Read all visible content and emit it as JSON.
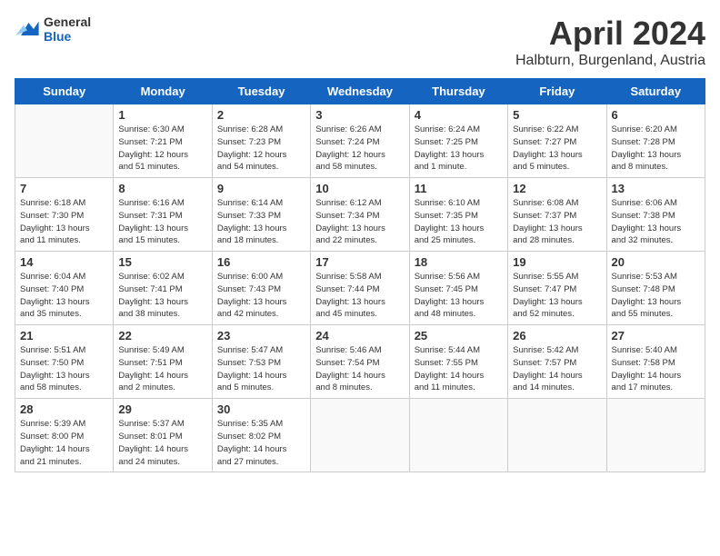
{
  "header": {
    "logo_general": "General",
    "logo_blue": "Blue",
    "month_title": "April 2024",
    "location": "Halbturn, Burgenland, Austria"
  },
  "weekdays": [
    "Sunday",
    "Monday",
    "Tuesday",
    "Wednesday",
    "Thursday",
    "Friday",
    "Saturday"
  ],
  "weeks": [
    [
      {
        "day": "",
        "info": ""
      },
      {
        "day": "1",
        "info": "Sunrise: 6:30 AM\nSunset: 7:21 PM\nDaylight: 12 hours\nand 51 minutes."
      },
      {
        "day": "2",
        "info": "Sunrise: 6:28 AM\nSunset: 7:23 PM\nDaylight: 12 hours\nand 54 minutes."
      },
      {
        "day": "3",
        "info": "Sunrise: 6:26 AM\nSunset: 7:24 PM\nDaylight: 12 hours\nand 58 minutes."
      },
      {
        "day": "4",
        "info": "Sunrise: 6:24 AM\nSunset: 7:25 PM\nDaylight: 13 hours\nand 1 minute."
      },
      {
        "day": "5",
        "info": "Sunrise: 6:22 AM\nSunset: 7:27 PM\nDaylight: 13 hours\nand 5 minutes."
      },
      {
        "day": "6",
        "info": "Sunrise: 6:20 AM\nSunset: 7:28 PM\nDaylight: 13 hours\nand 8 minutes."
      }
    ],
    [
      {
        "day": "7",
        "info": "Sunrise: 6:18 AM\nSunset: 7:30 PM\nDaylight: 13 hours\nand 11 minutes."
      },
      {
        "day": "8",
        "info": "Sunrise: 6:16 AM\nSunset: 7:31 PM\nDaylight: 13 hours\nand 15 minutes."
      },
      {
        "day": "9",
        "info": "Sunrise: 6:14 AM\nSunset: 7:33 PM\nDaylight: 13 hours\nand 18 minutes."
      },
      {
        "day": "10",
        "info": "Sunrise: 6:12 AM\nSunset: 7:34 PM\nDaylight: 13 hours\nand 22 minutes."
      },
      {
        "day": "11",
        "info": "Sunrise: 6:10 AM\nSunset: 7:35 PM\nDaylight: 13 hours\nand 25 minutes."
      },
      {
        "day": "12",
        "info": "Sunrise: 6:08 AM\nSunset: 7:37 PM\nDaylight: 13 hours\nand 28 minutes."
      },
      {
        "day": "13",
        "info": "Sunrise: 6:06 AM\nSunset: 7:38 PM\nDaylight: 13 hours\nand 32 minutes."
      }
    ],
    [
      {
        "day": "14",
        "info": "Sunrise: 6:04 AM\nSunset: 7:40 PM\nDaylight: 13 hours\nand 35 minutes."
      },
      {
        "day": "15",
        "info": "Sunrise: 6:02 AM\nSunset: 7:41 PM\nDaylight: 13 hours\nand 38 minutes."
      },
      {
        "day": "16",
        "info": "Sunrise: 6:00 AM\nSunset: 7:43 PM\nDaylight: 13 hours\nand 42 minutes."
      },
      {
        "day": "17",
        "info": "Sunrise: 5:58 AM\nSunset: 7:44 PM\nDaylight: 13 hours\nand 45 minutes."
      },
      {
        "day": "18",
        "info": "Sunrise: 5:56 AM\nSunset: 7:45 PM\nDaylight: 13 hours\nand 48 minutes."
      },
      {
        "day": "19",
        "info": "Sunrise: 5:55 AM\nSunset: 7:47 PM\nDaylight: 13 hours\nand 52 minutes."
      },
      {
        "day": "20",
        "info": "Sunrise: 5:53 AM\nSunset: 7:48 PM\nDaylight: 13 hours\nand 55 minutes."
      }
    ],
    [
      {
        "day": "21",
        "info": "Sunrise: 5:51 AM\nSunset: 7:50 PM\nDaylight: 13 hours\nand 58 minutes."
      },
      {
        "day": "22",
        "info": "Sunrise: 5:49 AM\nSunset: 7:51 PM\nDaylight: 14 hours\nand 2 minutes."
      },
      {
        "day": "23",
        "info": "Sunrise: 5:47 AM\nSunset: 7:53 PM\nDaylight: 14 hours\nand 5 minutes."
      },
      {
        "day": "24",
        "info": "Sunrise: 5:46 AM\nSunset: 7:54 PM\nDaylight: 14 hours\nand 8 minutes."
      },
      {
        "day": "25",
        "info": "Sunrise: 5:44 AM\nSunset: 7:55 PM\nDaylight: 14 hours\nand 11 minutes."
      },
      {
        "day": "26",
        "info": "Sunrise: 5:42 AM\nSunset: 7:57 PM\nDaylight: 14 hours\nand 14 minutes."
      },
      {
        "day": "27",
        "info": "Sunrise: 5:40 AM\nSunset: 7:58 PM\nDaylight: 14 hours\nand 17 minutes."
      }
    ],
    [
      {
        "day": "28",
        "info": "Sunrise: 5:39 AM\nSunset: 8:00 PM\nDaylight: 14 hours\nand 21 minutes."
      },
      {
        "day": "29",
        "info": "Sunrise: 5:37 AM\nSunset: 8:01 PM\nDaylight: 14 hours\nand 24 minutes."
      },
      {
        "day": "30",
        "info": "Sunrise: 5:35 AM\nSunset: 8:02 PM\nDaylight: 14 hours\nand 27 minutes."
      },
      {
        "day": "",
        "info": ""
      },
      {
        "day": "",
        "info": ""
      },
      {
        "day": "",
        "info": ""
      },
      {
        "day": "",
        "info": ""
      }
    ]
  ]
}
